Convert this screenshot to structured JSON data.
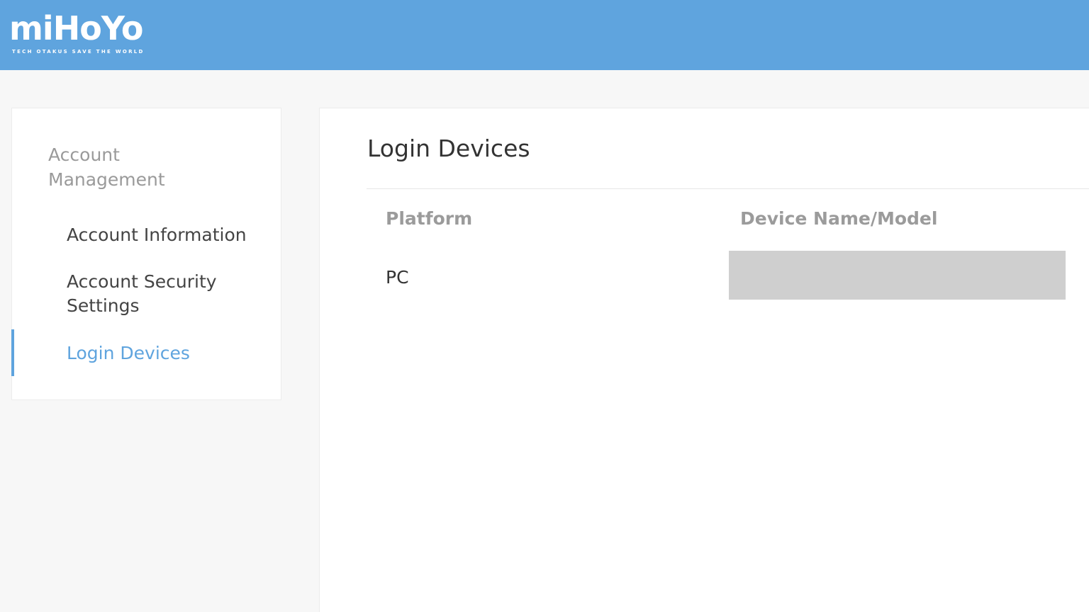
{
  "header": {
    "logo_text": "miHoYo",
    "logo_tagline": "TECH OTAKUS SAVE THE WORLD",
    "background_color": "#5fa4de"
  },
  "sidebar": {
    "heading": "Account Management",
    "items": [
      {
        "label": "Account Information",
        "active": false
      },
      {
        "label": "Account Security Settings",
        "active": false
      },
      {
        "label": "Login Devices",
        "active": true
      }
    ],
    "accent_color": "#5fa4de"
  },
  "main": {
    "title": "Login Devices",
    "table": {
      "columns": [
        "Platform",
        "Device Name/Model"
      ],
      "rows": [
        {
          "platform": "PC",
          "device_name_redacted": true
        }
      ]
    }
  }
}
